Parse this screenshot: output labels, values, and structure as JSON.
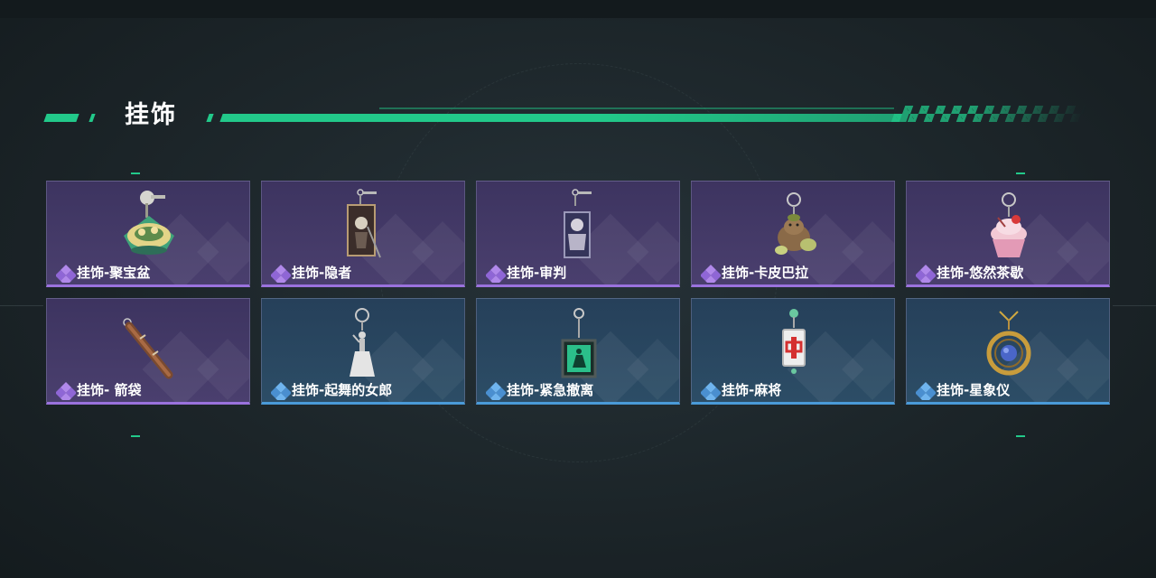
{
  "section": {
    "title": "挂饰"
  },
  "colors": {
    "accent": "#22c98a",
    "epic": "#9a72dd",
    "rare": "#4a9ad8"
  },
  "items": [
    {
      "name": "挂饰-聚宝盆",
      "rarity": "epic",
      "icon": "treasure-bowl-icon"
    },
    {
      "name": "挂饰-隐者",
      "rarity": "epic",
      "icon": "hermit-card-icon"
    },
    {
      "name": "挂饰-审判",
      "rarity": "epic",
      "icon": "judgement-card-icon"
    },
    {
      "name": "挂饰-卡皮巴拉",
      "rarity": "epic",
      "icon": "capybara-icon"
    },
    {
      "name": "挂饰-悠然茶歇",
      "rarity": "epic",
      "icon": "cupcake-icon"
    },
    {
      "name": "挂饰- 箭袋",
      "rarity": "epic",
      "icon": "quiver-icon"
    },
    {
      "name": "挂饰-起舞的女郎",
      "rarity": "rare",
      "icon": "dancing-lady-icon"
    },
    {
      "name": "挂饰-紧急撤离",
      "rarity": "rare",
      "icon": "emergency-exit-sign-icon"
    },
    {
      "name": "挂饰-麻将",
      "rarity": "rare",
      "icon": "mahjong-tile-icon"
    },
    {
      "name": "挂饰-星象仪",
      "rarity": "rare",
      "icon": "astrolabe-icon"
    }
  ]
}
